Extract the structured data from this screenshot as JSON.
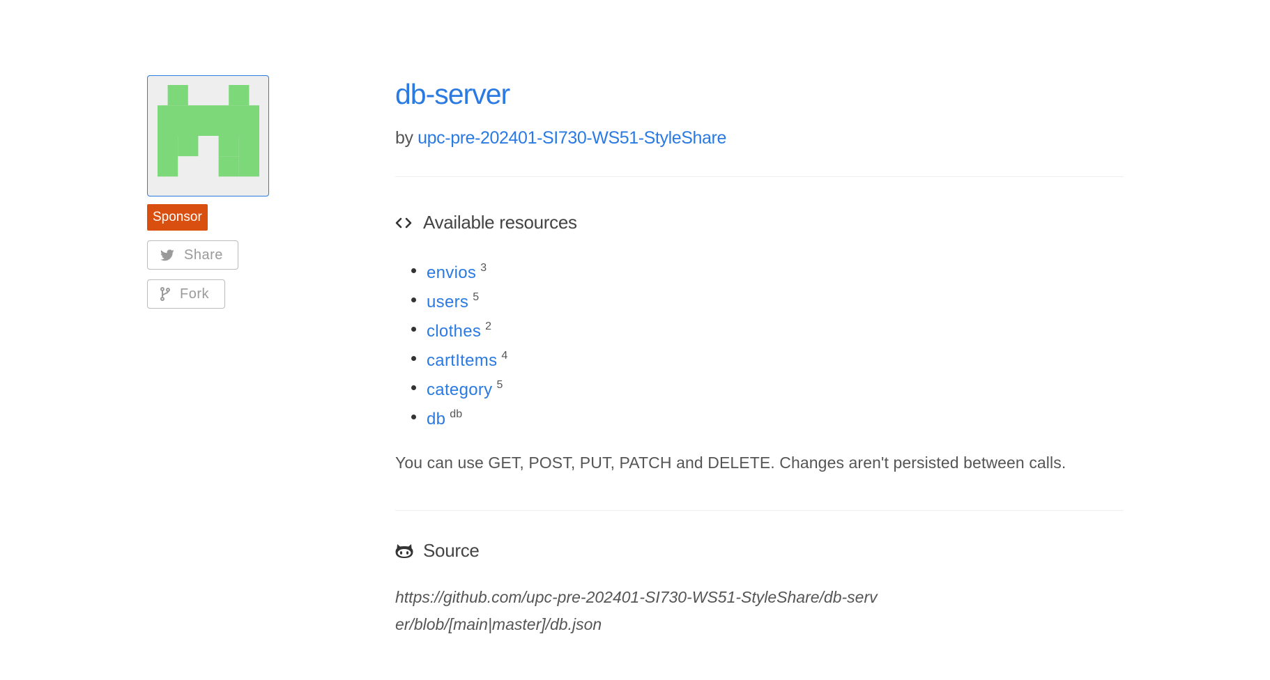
{
  "sidebar": {
    "avatar_icon": "pixel-avatar-icon",
    "avatar_color": "#7dd87a",
    "sponsor_label": "Sponsor",
    "share_label": "Share",
    "fork_label": "Fork"
  },
  "main": {
    "title": "db-server",
    "by_prefix": "by",
    "author": "upc-pre-202401-SI730-WS51-StyleShare",
    "resources_heading": "Available resources",
    "resources": [
      {
        "name": "envios",
        "count": "3"
      },
      {
        "name": "users",
        "count": "5"
      },
      {
        "name": "clothes",
        "count": "2"
      },
      {
        "name": "cartItems",
        "count": "4"
      },
      {
        "name": "category",
        "count": "5"
      },
      {
        "name": "db",
        "count": "db"
      }
    ],
    "usage_text": "You can use GET, POST, PUT, PATCH and DELETE. Changes aren't persisted between calls.",
    "source_heading": "Source",
    "source_url": "https://github.com/upc-pre-202401-SI730-WS51-StyleShare/db-server/blob/[main|master]/db.json"
  },
  "colors": {
    "link": "#2a7ae2",
    "sponsor": "#d94f0f"
  }
}
